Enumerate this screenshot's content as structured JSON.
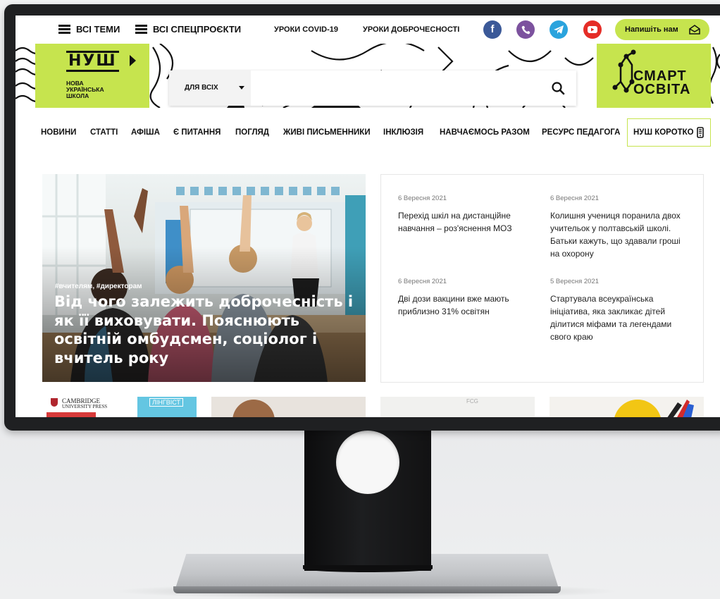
{
  "topbar": {
    "all_topics": "ВСІ ТЕМИ",
    "all_projects": "ВСІ СПЕЦПРОЄКТИ",
    "covid_lessons": "УРОКИ COVID-19",
    "integrity_lessons": "УРОКИ ДОБРОЧЕСНОСТІ",
    "social": [
      "facebook-icon",
      "viber-icon",
      "telegram-icon",
      "youtube-icon"
    ],
    "write_us": "Напишіть нам"
  },
  "logo": {
    "mark": "НУШ",
    "line1": "НОВА",
    "line2": "УКРАЇНСЬКА",
    "line3": "ШКОЛА"
  },
  "search": {
    "audience": "ДЛЯ ВСІХ",
    "placeholder": ""
  },
  "partner_logo": {
    "line1": "СМАРТ",
    "line2": "ОСВІТА"
  },
  "nav": {
    "items": [
      "НОВИНИ",
      "СТАТТІ",
      "АФІША",
      "Є ПИТАННЯ",
      "ПОГЛЯД",
      "ЖИВІ ПИСЬМЕННИКИ",
      "ІНКЛЮЗІЯ",
      "НАВЧАЄМОСЬ РАЗОМ",
      "РЕСУРС ПЕДАГОГА"
    ],
    "short": "НУШ КОРОТКО"
  },
  "hero": {
    "tags": "#вчителям, #директорам",
    "title": "Від чого залежить доброчесність і як її виховувати. Пояснюють освітній омбудсмен, соціолог і вчитель року"
  },
  "news": [
    {
      "date": "6 Вересня 2021",
      "title": "Перехід шкіл на дистанційне навчання – роз'яснення МОЗ"
    },
    {
      "date": "6 Вересня 2021",
      "title": "Колишня учениця поранила двох учительок у полтавській школі. Батьки кажуть, що здавали гроші на охорону"
    },
    {
      "date": "6 Вересня 2021",
      "title": "Дві дози вакцини вже мають приблизно 31% освітян"
    },
    {
      "date": "5 Вересня 2021",
      "title": "Стартувала всеукраїнська ініціатива, яка закликає дітей ділитися міфами та легендами свого краю"
    }
  ],
  "thumbs": {
    "cambridge": "CAMBRIDGE",
    "press": "UNIVERSITY PRESS",
    "lingvist": "ЛІНГВІСТ",
    "fcg": "FCG"
  },
  "colors": {
    "accent": "#c6e44e",
    "facebook": "#3b5998",
    "viber": "#7c529e",
    "telegram": "#2aa3dd",
    "youtube": "#e52d27"
  }
}
